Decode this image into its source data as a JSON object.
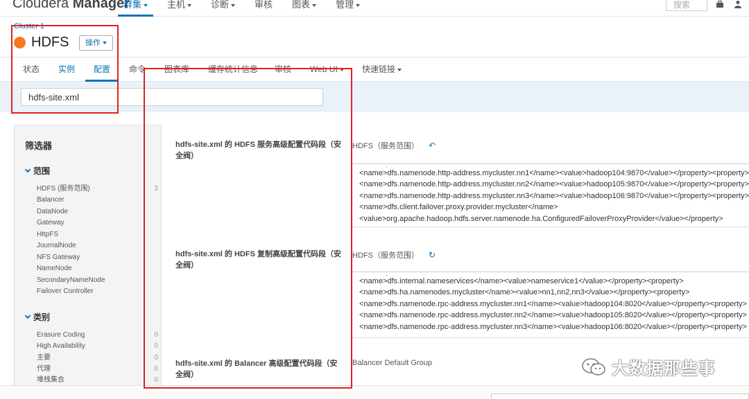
{
  "topnav": {
    "brand_light": "Cloudera ",
    "brand_bold": "Manager",
    "items": [
      {
        "label": "群集",
        "active": true
      },
      {
        "label": "主机"
      },
      {
        "label": "诊断"
      },
      {
        "label": "审核"
      },
      {
        "label": "图表"
      },
      {
        "label": "管理"
      }
    ],
    "search_placeholder": "搜索"
  },
  "service": {
    "breadcrumb": "Cluster 1",
    "name": "HDFS",
    "status_color": "#f37a1f",
    "actions_label": "操作"
  },
  "tabs": [
    {
      "label": "状态"
    },
    {
      "label": "实例"
    },
    {
      "label": "配置"
    },
    {
      "label": "命令"
    },
    {
      "label": "图表库"
    },
    {
      "label": "缓存统计信息"
    },
    {
      "label": "审核"
    },
    {
      "label": "Web UI"
    },
    {
      "label": "快速链接"
    }
  ],
  "filter": {
    "value": "hdfs-site.xml"
  },
  "sidebar": {
    "title": "筛选器",
    "scope_group": "范围",
    "scope_items": [
      {
        "label": "HDFS (服务范围)",
        "count": "2"
      },
      {
        "label": "Balancer",
        "count": ""
      },
      {
        "label": "DataNode",
        "count": ""
      },
      {
        "label": "Gateway",
        "count": ""
      },
      {
        "label": "HttpFS",
        "count": ""
      },
      {
        "label": "JournalNode",
        "count": ""
      },
      {
        "label": "NFS Gateway",
        "count": ""
      },
      {
        "label": "NameNode",
        "count": ""
      },
      {
        "label": "SecondaryNameNode",
        "count": ""
      },
      {
        "label": "Failover Controller",
        "count": ""
      }
    ],
    "category_group": "类别",
    "category_items": [
      {
        "label": "Erasure Coding",
        "count": "0"
      },
      {
        "label": "High Availability",
        "count": "0"
      },
      {
        "label": "主要",
        "count": "0"
      },
      {
        "label": "代理",
        "count": "0"
      },
      {
        "label": "堆栈集合",
        "count": "0"
      }
    ]
  },
  "configs": [
    {
      "label": "hdfs-site.xml 的 HDFS 服务高级配置代码段（安全阀）",
      "scope": "HDFS（服务范围）",
      "lines": [
        "<name>dfs.namenode.http-address.mycluster.nn1</name><value>hadoop104:9870</value></property><property>",
        "<name>dfs.namenode.http-address.mycluster.nn2</name><value>hadoop105:9870</value></property><property>",
        "<name>dfs.namenode.http-address.mycluster.nn3</name><value>hadoop106:9870</value></property><property>",
        "<name>dfs.client.failover.proxy.provider.mycluster</name>",
        "<value>org.apache.hadoop.hdfs.server.namenode.ha.ConfiguredFailoverProxyProvider</value></property>"
      ]
    },
    {
      "label": "hdfs-site.xml 的 HDFS 复制高级配置代码段（安全阀）",
      "scope": "HDFS（服务范围）",
      "lines": [
        "<name>dfs.internal.nameservices</name><value>nameservice1</value></property><property>",
        "<name>dfs.ha.namenodes.mycluster</name><value>nn1,nn2,nn3</value></property><property>",
        "<name>dfs.namenode.rpc-address.mycluster.nn1</name><value>hadoop104:8020</value></property><property>",
        "<name>dfs.namenode.rpc-address.mycluster.nn2</name><value>hadoop105:8020</value></property><property>",
        "<name>dfs.namenode.rpc-address.mycluster.nn3</name><value>hadoop106:8020</value></property><property>"
      ]
    },
    {
      "label": "hdfs-site.xml 的 Balancer 高级配置代码段（安全阀）",
      "scope": "Balancer Default Group"
    }
  ],
  "watermark": {
    "text": "大数据那些事"
  },
  "accent_color": "#0b72b5",
  "highlight_color": "#e21f1f"
}
